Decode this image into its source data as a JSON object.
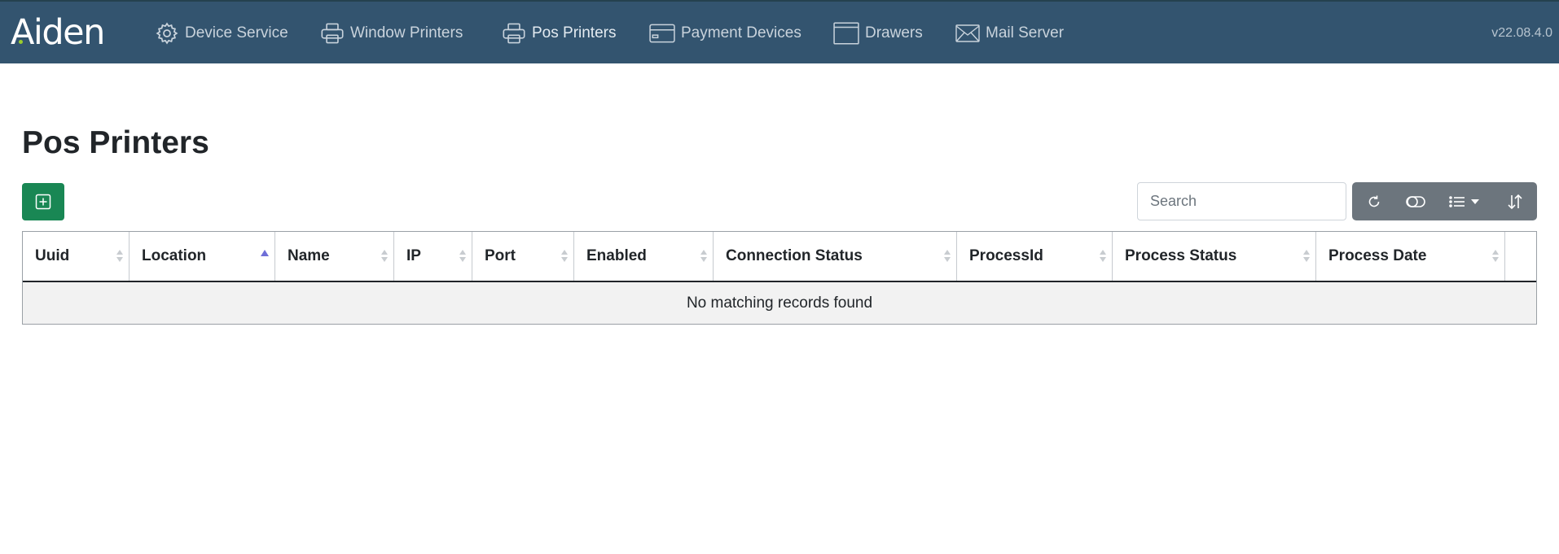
{
  "brand": {
    "name": "Aiden"
  },
  "nav": {
    "items": [
      {
        "label": "Device Service",
        "icon": "gear-icon"
      },
      {
        "label": "Window Printers",
        "icon": "printer-icon"
      },
      {
        "label": "Pos Printers",
        "icon": "printer-icon",
        "active": true
      },
      {
        "label": "Payment Devices",
        "icon": "credit-card-icon"
      },
      {
        "label": "Drawers",
        "icon": "drawer-icon"
      },
      {
        "label": "Mail Server",
        "icon": "envelope-icon"
      }
    ],
    "version": "v22.08.4.0"
  },
  "page": {
    "title": "Pos Printers",
    "add_icon": "plus-square-icon"
  },
  "search": {
    "placeholder": "Search",
    "value": ""
  },
  "toolbar": {
    "buttons": [
      {
        "icon": "refresh-icon"
      },
      {
        "icon": "toggle-icon"
      },
      {
        "icon": "columns-list-icon",
        "has_dropdown": true
      },
      {
        "icon": "sort-icon"
      }
    ]
  },
  "table": {
    "columns": [
      {
        "label": "Uuid",
        "sort": "none"
      },
      {
        "label": "Location",
        "sort": "asc"
      },
      {
        "label": "Name",
        "sort": "none"
      },
      {
        "label": "IP",
        "sort": "none"
      },
      {
        "label": "Port",
        "sort": "none"
      },
      {
        "label": "Enabled",
        "sort": "none"
      },
      {
        "label": "Connection Status",
        "sort": "none"
      },
      {
        "label": "ProcessId",
        "sort": "none"
      },
      {
        "label": "Process Status",
        "sort": "none"
      },
      {
        "label": "Process Date",
        "sort": "none"
      },
      {
        "label": "",
        "sort": "none"
      }
    ],
    "rows": [],
    "empty_message": "No matching records found"
  },
  "colors": {
    "navbar": "#33546f",
    "add_button": "#198754",
    "toolbar": "#6c757d",
    "sort_active": "#6f6fd8"
  }
}
